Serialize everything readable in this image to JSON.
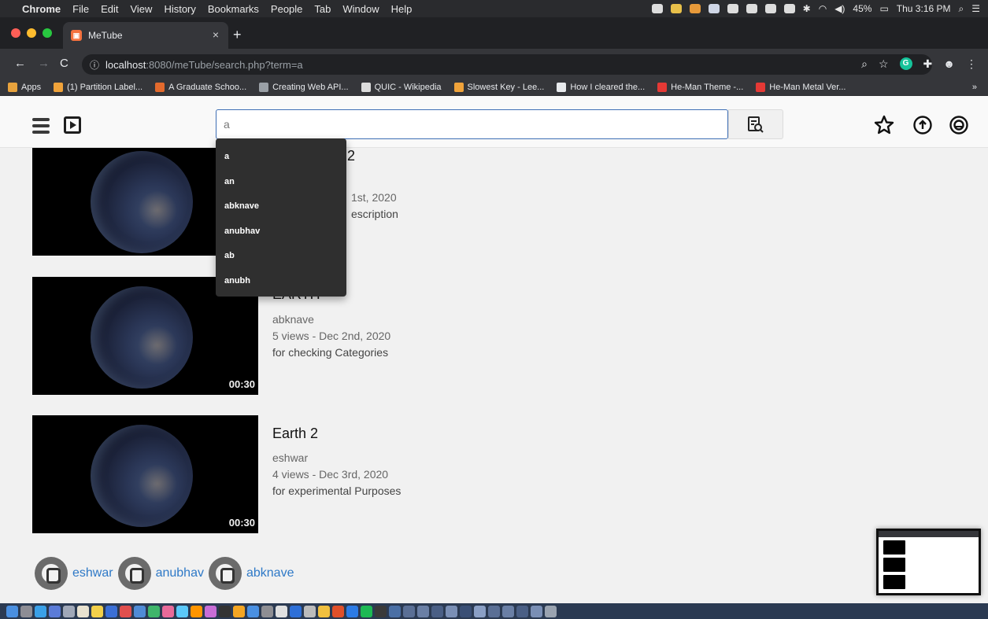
{
  "menubar": {
    "items": [
      "Chrome",
      "File",
      "Edit",
      "View",
      "History",
      "Bookmarks",
      "People",
      "Tab",
      "Window",
      "Help"
    ],
    "battery": "45%",
    "clock": "Thu 3:16 PM"
  },
  "browser": {
    "tab_title": "MeTube",
    "url_host": "localhost",
    "url_rest": ":8080/meTube/search.php?term=a",
    "bookmarks": [
      {
        "label": "Apps",
        "color": "#e8a33d"
      },
      {
        "label": "(1) Partition Label...",
        "color": "#f0a33a"
      },
      {
        "label": "A Graduate Schoo...",
        "color": "#e36a2d"
      },
      {
        "label": "Creating Web API...",
        "color": "#9aa0a6"
      },
      {
        "label": "QUIC - Wikipedia",
        "color": "#dcdcdc"
      },
      {
        "label": "Slowest Key - Lee...",
        "color": "#f0a33a"
      },
      {
        "label": "How I cleared the...",
        "color": "#e8eaed"
      },
      {
        "label": "He-Man Theme -...",
        "color": "#e53935"
      },
      {
        "label": "He-Man Metal Ver...",
        "color": "#e53935"
      }
    ],
    "bookmarks_more": "»"
  },
  "header": {
    "search_value": "a"
  },
  "suggestions": [
    "a",
    "an",
    "abknave",
    "anubhav",
    "ab",
    "anubh"
  ],
  "results": [
    {
      "title": "Earth 2",
      "title_visible": "2",
      "channel": "",
      "stats": "1st, 2020",
      "description": "escription",
      "duration": ""
    },
    {
      "title": "EARTH",
      "channel": "abknave",
      "stats": "5 views - Dec 2nd, 2020",
      "description": "for checking Categories",
      "duration": "00:30"
    },
    {
      "title": "Earth 2",
      "channel": "eshwar",
      "stats": "4 views - Dec 3rd, 2020",
      "description": "for experimental Purposes",
      "duration": "00:30"
    }
  ],
  "users": [
    "eshwar",
    "anubhav",
    "abknave"
  ],
  "colors": {
    "accent": "#2e79c7",
    "search_border": "#3f6fb5",
    "dropdown_bg": "#2f2f2f"
  }
}
